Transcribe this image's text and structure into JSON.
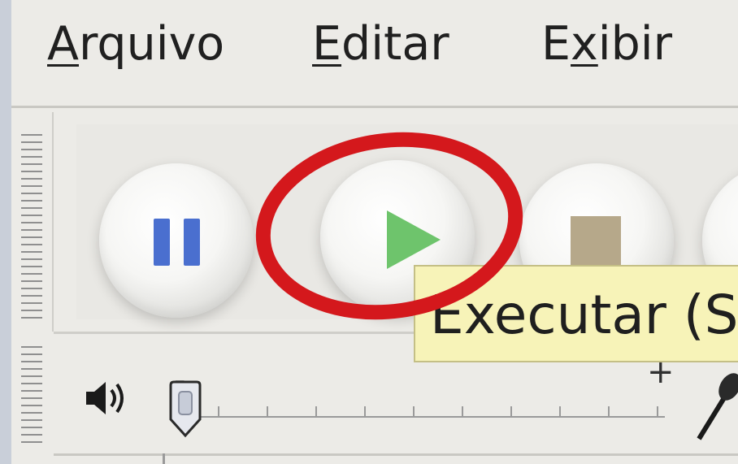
{
  "menubar": {
    "items": [
      {
        "label": "Arquivo",
        "mnemonic": "A",
        "rest": "rquivo"
      },
      {
        "label": "Editar",
        "mnemonic": "E",
        "rest": "ditar"
      },
      {
        "label": "Exibir",
        "prefix": "E",
        "mnemonic": "x",
        "rest": "ibir"
      }
    ]
  },
  "toolbar": {
    "buttons": [
      {
        "name": "pause",
        "icon": "pause-icon"
      },
      {
        "name": "play",
        "icon": "play-icon"
      },
      {
        "name": "stop",
        "icon": "stop-icon"
      }
    ],
    "tooltip": "Executar (S"
  },
  "meter": {
    "volume_icon": "speaker-icon",
    "min_label": "-",
    "max_label": "+",
    "mic_icon": "microphone-icon",
    "volume_level": 0.0
  },
  "annotation": {
    "highlight_color": "#d4181c",
    "highlight_target": "play-button"
  },
  "colors": {
    "pause": "#4a6fcf",
    "play": "#6ec46c",
    "stop": "#b6a88a",
    "tooltip_bg": "#f7f3b8"
  }
}
